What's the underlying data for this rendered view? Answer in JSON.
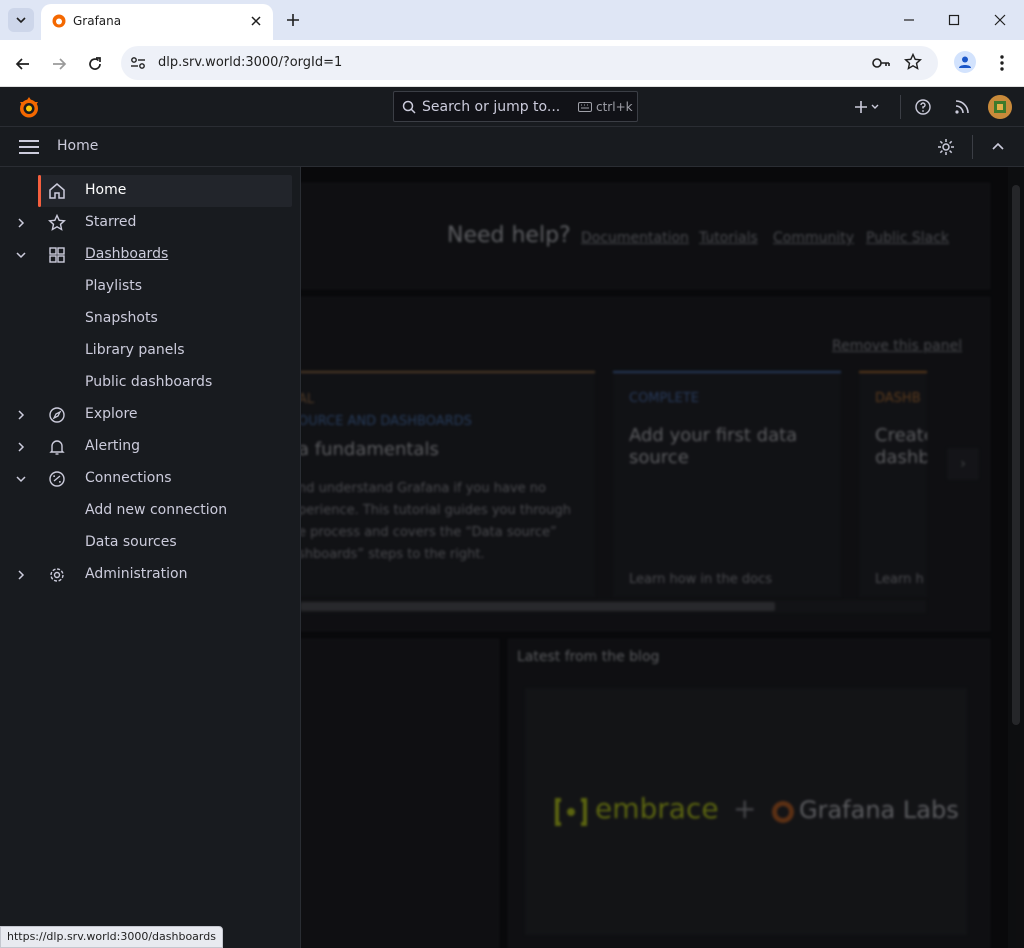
{
  "browser": {
    "tab_title": "Grafana",
    "url": "dlp.srv.world:3000/?orgId=1",
    "status_url": "https://dlp.srv.world:3000/dashboards"
  },
  "grafana": {
    "search_placeholder": "Search or jump to...",
    "search_shortcut": "ctrl+k",
    "breadcrumb": "Home"
  },
  "sidebar": {
    "items": [
      {
        "label": "Home",
        "icon": "home-icon"
      },
      {
        "label": "Starred",
        "icon": "star-icon"
      },
      {
        "label": "Dashboards",
        "icon": "apps-icon"
      },
      {
        "label": "Playlists"
      },
      {
        "label": "Snapshots"
      },
      {
        "label": "Library panels"
      },
      {
        "label": "Public dashboards"
      },
      {
        "label": "Explore",
        "icon": "compass-icon"
      },
      {
        "label": "Alerting",
        "icon": "bell-icon"
      },
      {
        "label": "Connections",
        "icon": "link-icon"
      },
      {
        "label": "Add new connection"
      },
      {
        "label": "Data sources"
      },
      {
        "label": "Administration",
        "icon": "cog-icon"
      }
    ]
  },
  "main": {
    "help_title": "Need help?",
    "help_links": [
      "Documentation",
      "Tutorials",
      "Community",
      "Public Slack"
    ],
    "remove_panel": "Remove this panel",
    "tutorial": {
      "tag1": "AL",
      "tag2": "OURCE AND DASHBOARDS",
      "title": "a fundamentals",
      "lines": [
        "nd understand Grafana if you have no",
        "perience. This tutorial guides you through",
        "e process and covers the “Data source”",
        "shboards” steps to the right."
      ]
    },
    "card_complete": {
      "tag": "COMPLETE",
      "title_line1": "Add your first data",
      "title_line2": "source",
      "link": "Learn how in the docs"
    },
    "card_dash": {
      "tag": "DASHB",
      "title_line1": "Create",
      "title_line2": "dashb",
      "link": "Learn h"
    },
    "blog_title": "Latest from the blog",
    "blog_brand1": "embrace",
    "blog_plus": "+",
    "blog_brand2": "Grafana Labs"
  },
  "colors": {
    "accent": "#f55f3e",
    "complete_blue": "#3d71d9",
    "dash_orange": "#ff7f2a"
  }
}
